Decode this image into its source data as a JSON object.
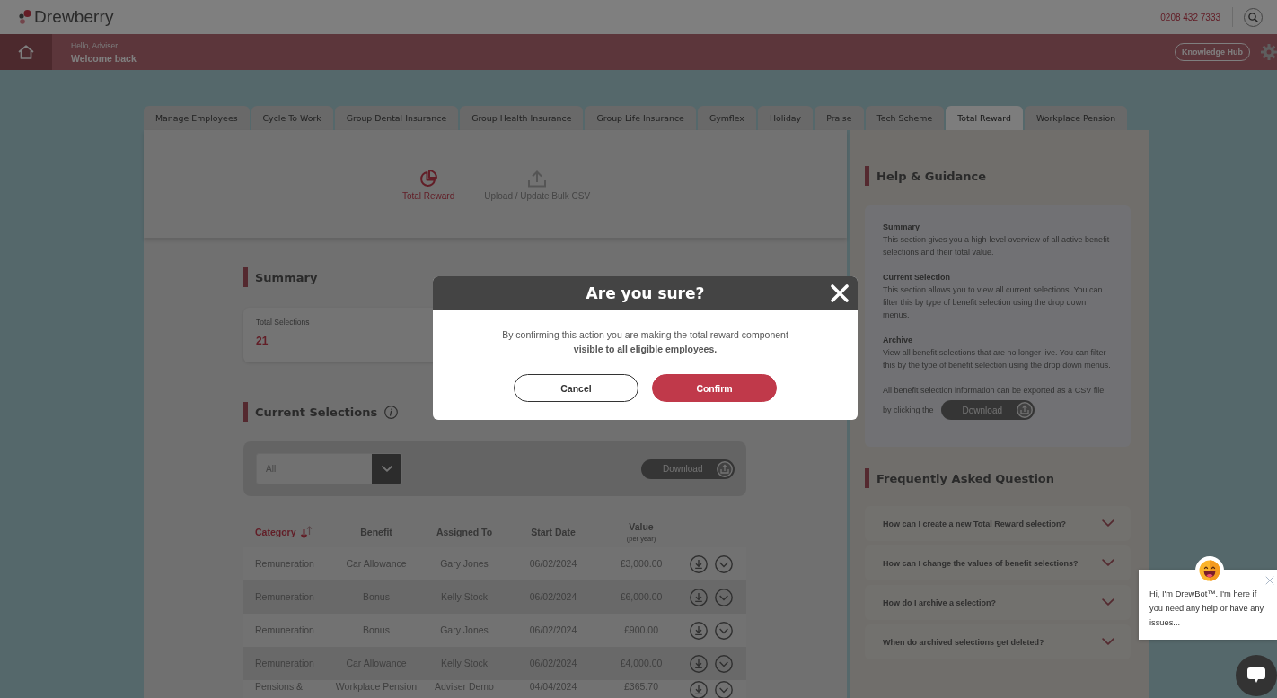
{
  "header": {
    "logo": "Drewberry",
    "phone": "0208 432 7333"
  },
  "welcome_bar": {
    "greeting": "Hello, Adviser",
    "title": "Welcome back",
    "link": "Knowledge Hub"
  },
  "tabs": [
    {
      "label": "Manage Employees",
      "selected": false
    },
    {
      "label": "Cycle To Work",
      "selected": false
    },
    {
      "label": "Group Dental Insurance",
      "selected": false
    },
    {
      "label": "Group Health Insurance",
      "selected": false
    },
    {
      "label": "Group Life Insurance",
      "selected": false
    },
    {
      "label": "Gymflex",
      "selected": false
    },
    {
      "label": "Holiday",
      "selected": false
    },
    {
      "label": "Praise",
      "selected": false
    },
    {
      "label": "Tech Scheme",
      "selected": false
    },
    {
      "label": "Total Reward",
      "selected": true
    },
    {
      "label": "Workplace Pension",
      "selected": false
    }
  ],
  "page_actions": [
    {
      "label": "Total Reward",
      "selected": true
    },
    {
      "label": "Upload / Update Bulk CSV",
      "selected": false
    }
  ],
  "summary": {
    "title": "Summary",
    "stats": [
      {
        "label": "Total Selections",
        "value": "21"
      }
    ]
  },
  "current_selections": {
    "title": "Current Selections",
    "filter": {
      "value": "All"
    },
    "download_button": "Download",
    "table": {
      "columns": [
        {
          "label": "Category",
          "sorted": true
        },
        {
          "label": "Benefit",
          "sorted": false
        },
        {
          "label": "Assigned To",
          "sorted": false
        },
        {
          "label": "Start Date",
          "sorted": false
        },
        {
          "label": "Value",
          "note": "(per year)",
          "sorted": false
        }
      ],
      "rows": [
        {
          "category": "Remuneration",
          "benefit": "Car Allowance",
          "assigned_to": "Gary Jones",
          "start_date": "06/02/2024",
          "value": "£3,000.00"
        },
        {
          "category": "Remuneration",
          "benefit": "Bonus",
          "assigned_to": "Kelly Stock",
          "start_date": "06/02/2024",
          "value": "£6,000.00"
        },
        {
          "category": "Remuneration",
          "benefit": "Bonus",
          "assigned_to": "Gary Jones",
          "start_date": "06/02/2024",
          "value": "£900.00"
        },
        {
          "category": "Remuneration",
          "benefit": "Car Allowance",
          "assigned_to": "Kelly Stock",
          "start_date": "06/02/2024",
          "value": "£4,000.00"
        },
        {
          "category": "Pensions &",
          "benefit": "Workplace Pension",
          "assigned_to": "Adviser Demo",
          "start_date": "04/04/2024",
          "value": "£365.70"
        }
      ]
    }
  },
  "help": {
    "title": "Help & Guidance",
    "sections": [
      {
        "heading": "Summary",
        "text": "This section gives you a high-level overview of all active benefit selections and their total value."
      },
      {
        "heading": "Current Selection",
        "text": "This section allows you to view all current selections. You can filter this by type of benefit selection using the drop down menus."
      },
      {
        "heading": "Archive",
        "text": "View all benefit selections that are no longer live. You can filter this by the type of benefit selection using the drop down menus."
      }
    ],
    "export_note": "All benefit selection information can be exported as a CSV file",
    "export_prefix": "by clicking the",
    "download_button": "Download"
  },
  "faq": {
    "title": "Frequently Asked Question",
    "items": [
      {
        "question": "How can I create a new Total Reward selection?",
        "expanded": false
      },
      {
        "question": "How can I change the values of benefit selections?",
        "expanded": false
      },
      {
        "question": "How do I archive a selection?",
        "expanded": false
      },
      {
        "question": "When do archived selections get deleted?",
        "expanded": false
      }
    ]
  },
  "modal": {
    "title": "Are you sure?",
    "message": "By confirming this action you are making the total reward component **visible to all eligible employees.**",
    "buttons": [
      {
        "label": "Cancel",
        "kind": "secondary"
      },
      {
        "label": "Confirm",
        "kind": "primary"
      }
    ]
  },
  "chatbot": {
    "message": "Hi, I'm DrewBot™. I'm here if you need any help or have any issues..."
  }
}
